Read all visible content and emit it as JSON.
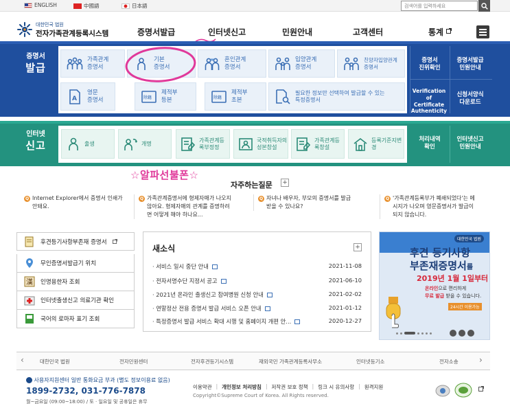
{
  "topbar": {
    "languages": [
      {
        "label": "ENGLISH",
        "flag": "us-flag"
      },
      {
        "label": "中國語",
        "flag": "china-flag"
      },
      {
        "label": "日本語",
        "flag": "japan-flag"
      }
    ],
    "search_placeholder": "검색어를 입력하세요"
  },
  "header": {
    "logo_small": "대한민국 법원",
    "logo_main": "전자가족관계등록시스템",
    "nav": [
      "증명서발급",
      "인터넷신고",
      "민원안내",
      "고객센터",
      "통계"
    ]
  },
  "cert": {
    "title_small": "증명서",
    "title_big": "발급",
    "buttons": [
      {
        "line1": "가족관계",
        "line2": "증명서",
        "icon": "family-icon"
      },
      {
        "line1": "기본",
        "line2": "증명서",
        "icon": "person-icon"
      },
      {
        "line1": "혼인관계",
        "line2": "증명서",
        "icon": "couple-icon"
      },
      {
        "line1": "입양관계",
        "line2": "증명서",
        "icon": "adoption-icon"
      },
      {
        "line1": "친양자입양관계",
        "line2": "증명서",
        "icon": "family-adoption-icon"
      },
      {
        "line1": "영문",
        "line2": "증명서",
        "icon": "english-document-icon"
      },
      {
        "line1": "제적부",
        "line2": "등본",
        "icon": "register-copy-icon"
      },
      {
        "line1": "제적부",
        "line2": "초본",
        "icon": "register-extract-icon"
      },
      {
        "line1": "필요한 정보만 선택하여 발급할 수 있는",
        "line2": "특정증명서",
        "icon": "search-document-icon"
      }
    ],
    "side": [
      {
        "line1": "증명서",
        "line2": "진위확인"
      },
      {
        "line1": "증명서발급",
        "line2": "민원안내"
      },
      {
        "line1": "Verification of",
        "line2": "Certificate",
        "line3": "Authenticity"
      },
      {
        "line1": "신청서양식",
        "line2": "다운로드"
      }
    ]
  },
  "report": {
    "title_small": "인터넷",
    "title_big": "신고",
    "buttons": [
      {
        "line1": "출생",
        "line2": "",
        "icon": "baby-icon"
      },
      {
        "line1": "개명",
        "line2": "",
        "icon": "rename-icon"
      },
      {
        "line1": "가족관계",
        "line2": "등록부정정",
        "icon": "correction-icon"
      },
      {
        "line1": "국적취득자의",
        "line2": "성본창설",
        "icon": "id-card-icon"
      },
      {
        "line1": "가족관계",
        "line2": "등록창설",
        "icon": "register-create-icon"
      },
      {
        "line1": "등록기준지",
        "line2": "변경",
        "icon": "home-change-icon"
      }
    ],
    "side": [
      {
        "line1": "처리내역",
        "line2": "확인"
      },
      {
        "line1": "인터넷신고",
        "line2": "민원안내"
      }
    ]
  },
  "promo_text": "☆알파선불폰☆",
  "faq": {
    "title": "자주하는질문",
    "items": [
      {
        "line1": "Internet Explorer에서 증명서 인쇄가",
        "line2": "안돼요."
      },
      {
        "line1": "가족관계증명서에 형제자매가 나오지",
        "line2": "않아요. 형제자매의 관계를 증명하려",
        "line3": "면 어떻게 해야 하나요..."
      },
      {
        "line1": "자녀나 배우자, 부모의 증명서를 발급",
        "line2": "받을 수 있나요?"
      },
      {
        "line1": "'가족관계등록부가 폐쇄되었다'는 메",
        "line2": "시지가 나오며 영문증명서가 발급이",
        "line3": "되지 않습니다."
      }
    ]
  },
  "quick_links": [
    {
      "label": "후견등기사항부존재 증명서",
      "icon": "certificate-icon"
    },
    {
      "label": "무인증명서발급기 위치",
      "icon": "location-icon"
    },
    {
      "label": "인명용한자 조회",
      "icon": "hanja-icon"
    },
    {
      "label": "인터넷출생신고 의료기관 확인",
      "icon": "hospital-icon"
    },
    {
      "label": "국어의 로마자 표기 조회",
      "icon": "book-icon"
    }
  ],
  "news": {
    "title": "새소식",
    "items": [
      {
        "title": "서비스 일시 중단 안내",
        "date": "2021-11-08"
      },
      {
        "title": "전자서명수단 지정서 공고",
        "date": "2021-06-10"
      },
      {
        "title": "2021년 온라인 출생신고 참여병원 신청 안내",
        "date": "2021-02-02"
      },
      {
        "title": "연말정산 전용 증명서 발급 서비스 오픈 안내",
        "date": "2021-01-12"
      },
      {
        "title": "특정증명서 발급 서비스 확대 시행 및 홈페이지 개편 안...",
        "date": "2020-12-27"
      }
    ]
  },
  "banner": {
    "badge": "대한민국 법원",
    "line1": "후견 등기사항",
    "line2": "부존재증명서",
    "suffix": "를",
    "date_line": "2019년 1월 1일부터",
    "desc1a": "온라인",
    "desc1b": "으로 편리하게",
    "desc2a": "무료 발급",
    "desc2b": "받을 수 있습니다.",
    "tag": "24시간 이용가능"
  },
  "footer": {
    "orgs": [
      "대한민국 법원",
      "전자민원센터",
      "전자후견등기시스템",
      "재외국민 가족관계등록사무소",
      "인터넷등기소",
      "전자소송"
    ],
    "callcenter": "사용자지원센터  일반 통화요금 부과 (별도 정보이용료 없음)",
    "phone": "1899-2732, 031-776-7878",
    "hours": "월~금요일 (09:00~18:00) / 토 · 일요일 및 공휴일은 휴무",
    "links": [
      "이용약관",
      "개인정보 처리방침",
      "저작권 보호 정책",
      "링크 시 유의사항",
      "원격지원"
    ],
    "copyright": "Copyright©Supreme Court of Korea. All Rights reserved."
  },
  "colors": {
    "cert_band": "#1f4f9e",
    "report_band": "#23927f",
    "promo": "#e0399a",
    "faq_badge": "#e8902d"
  }
}
